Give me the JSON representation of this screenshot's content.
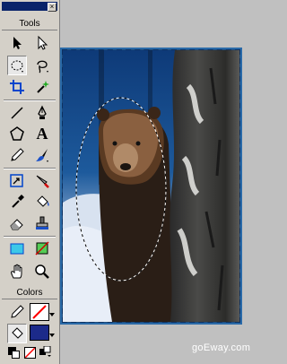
{
  "panel": {
    "tools_label": "Tools",
    "colors_label": "Colors",
    "tools": [
      {
        "name": "pointer-icon"
      },
      {
        "name": "subselect-icon"
      },
      {
        "name": "marquee-icon",
        "selected": true
      },
      {
        "name": "lasso-icon"
      },
      {
        "name": "crop-icon"
      },
      {
        "name": "magic-wand-icon"
      },
      {
        "name": "line-icon"
      },
      {
        "name": "pen-icon"
      },
      {
        "name": "polygon-icon"
      },
      {
        "name": "text-icon"
      },
      {
        "name": "pencil-icon"
      },
      {
        "name": "brush-icon"
      },
      {
        "name": "scale-icon"
      },
      {
        "name": "knife-icon"
      },
      {
        "name": "eyedropper-icon"
      },
      {
        "name": "paint-bucket-icon"
      },
      {
        "name": "eraser-icon"
      },
      {
        "name": "rubber-stamp-icon"
      },
      {
        "name": "rectangle-hotspot-icon"
      },
      {
        "name": "slice-icon"
      },
      {
        "name": "hand-icon"
      },
      {
        "name": "zoom-icon"
      }
    ],
    "colors": {
      "stroke_color": "#ff0000",
      "fill_color": "#1c2a8a"
    }
  },
  "canvas": {
    "selection": "elliptical marquee"
  },
  "watermark": "goEway.com",
  "text_tool_glyph": "A"
}
